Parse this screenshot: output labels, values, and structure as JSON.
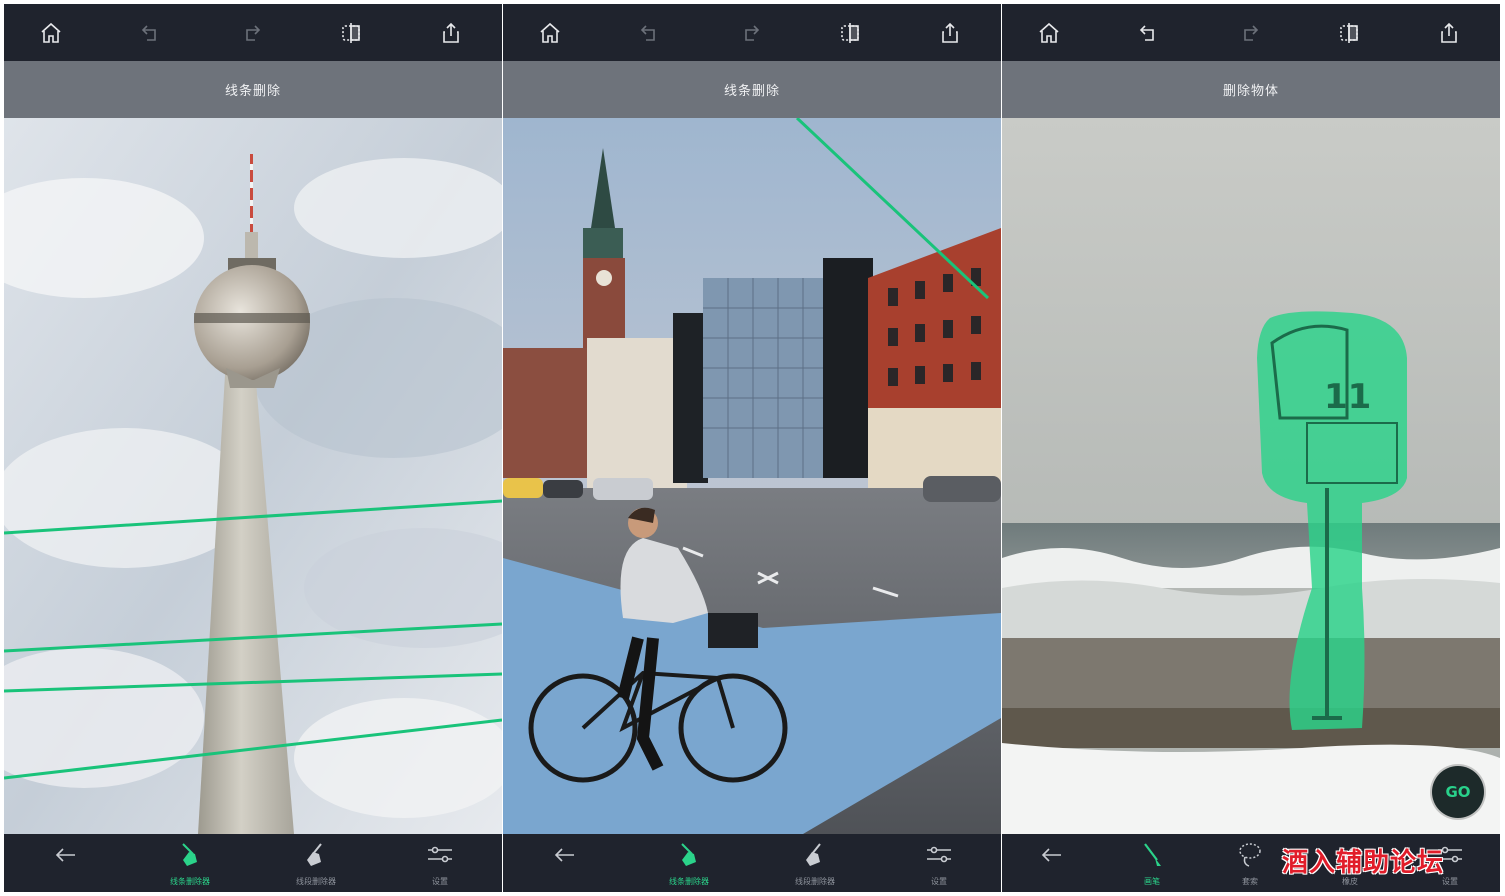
{
  "panels": [
    {
      "title": "线条删除",
      "toolbar": [
        "home-icon",
        "undo-icon",
        "redo-icon",
        "compare-icon",
        "share-icon"
      ],
      "bottom": [
        {
          "icon": "back-arrow-icon",
          "label": ""
        },
        {
          "icon": "line-remover-icon",
          "label": "线条删除器"
        },
        {
          "icon": "segment-remover-icon",
          "label": "线段删除器"
        },
        {
          "icon": "settings-sliders-icon",
          "label": "设置"
        }
      ],
      "active_tool": 1
    },
    {
      "title": "线条删除",
      "toolbar": [
        "home-icon",
        "undo-icon",
        "redo-icon",
        "compare-icon",
        "share-icon"
      ],
      "bottom": [
        {
          "icon": "back-arrow-icon",
          "label": ""
        },
        {
          "icon": "line-remover-icon",
          "label": "线条删除器"
        },
        {
          "icon": "segment-remover-icon",
          "label": "线段删除器"
        },
        {
          "icon": "settings-sliders-icon",
          "label": "设置"
        }
      ],
      "active_tool": 1
    },
    {
      "title": "删除物体",
      "toolbar": [
        "home-icon",
        "undo-icon",
        "redo-icon",
        "compare-icon",
        "share-icon"
      ],
      "bottom": [
        {
          "icon": "back-arrow-icon",
          "label": ""
        },
        {
          "icon": "brush-icon",
          "label": "画笔"
        },
        {
          "icon": "lasso-icon",
          "label": "套索"
        },
        {
          "icon": "eraser-icon",
          "label": "橡皮"
        },
        {
          "icon": "settings-sliders-icon",
          "label": "设置"
        }
      ],
      "active_tool": 1,
      "go_label": "GO"
    }
  ],
  "watermark": "酒入辅助论坛",
  "colors": {
    "accent": "#2bd38a",
    "toolbar_bg": "#1f232d",
    "title_bg": "#6e737b"
  }
}
